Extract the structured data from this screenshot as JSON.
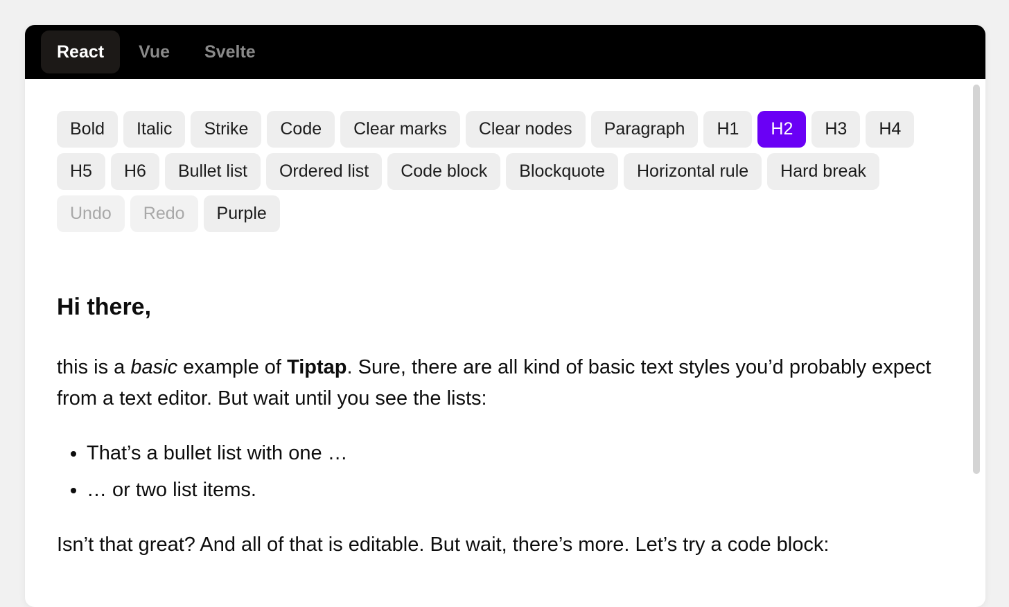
{
  "tabs": [
    {
      "label": "React",
      "active": true
    },
    {
      "label": "Vue",
      "active": false
    },
    {
      "label": "Svelte",
      "active": false
    }
  ],
  "toolbar": {
    "buttons": [
      {
        "label": "Bold",
        "state": "normal"
      },
      {
        "label": "Italic",
        "state": "normal"
      },
      {
        "label": "Strike",
        "state": "normal"
      },
      {
        "label": "Code",
        "state": "normal"
      },
      {
        "label": "Clear marks",
        "state": "normal"
      },
      {
        "label": "Clear nodes",
        "state": "normal"
      },
      {
        "label": "Paragraph",
        "state": "normal"
      },
      {
        "label": "H1",
        "state": "normal"
      },
      {
        "label": "H2",
        "state": "active"
      },
      {
        "label": "H3",
        "state": "normal"
      },
      {
        "label": "H4",
        "state": "normal"
      },
      {
        "label": "H5",
        "state": "normal"
      },
      {
        "label": "H6",
        "state": "normal"
      },
      {
        "label": "Bullet list",
        "state": "normal"
      },
      {
        "label": "Ordered list",
        "state": "normal"
      },
      {
        "label": "Code block",
        "state": "normal"
      },
      {
        "label": "Blockquote",
        "state": "normal"
      },
      {
        "label": "Horizontal rule",
        "state": "normal"
      },
      {
        "label": "Hard break",
        "state": "normal"
      },
      {
        "label": "Undo",
        "state": "disabled"
      },
      {
        "label": "Redo",
        "state": "disabled"
      },
      {
        "label": "Purple",
        "state": "normal"
      }
    ]
  },
  "editor": {
    "heading": "Hi there,",
    "paragraph1": {
      "text_a": "this is a ",
      "italic": "basic",
      "text_b": " example of ",
      "bold": "Tiptap",
      "text_c": ". Sure, there are all kind of basic text styles you’d probably expect from a text editor. But wait until you see the lists:"
    },
    "list_items": [
      "That’s a bullet list with one …",
      "… or two list items."
    ],
    "paragraph2": "Isn’t that great? And all of that is editable. But wait, there’s more. Let’s try a code block:"
  },
  "colors": {
    "accent": "#6a00f5",
    "tabbar_bg": "#000000",
    "active_tab_bg": "#1c1917",
    "button_bg": "#eeeeee",
    "page_bg": "#f1f1f1"
  }
}
